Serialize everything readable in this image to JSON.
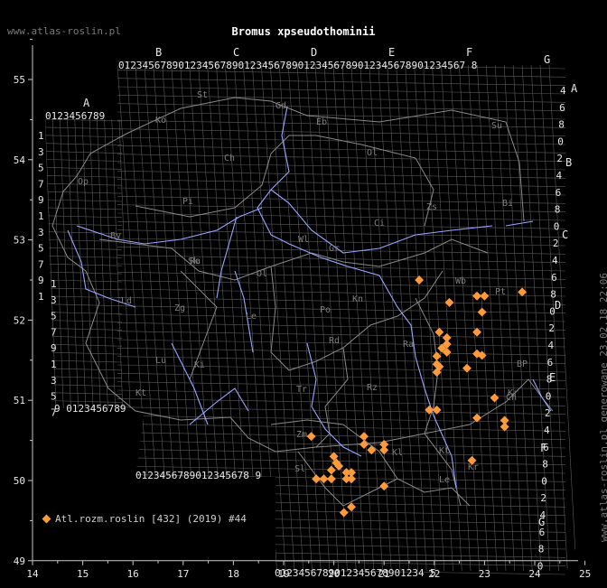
{
  "title": "Bromus xpseudothominii",
  "site": "www.atlas-roslin.pl",
  "side_text": "www.atlas-roslin.pl generowane 23.02.18 22:06",
  "legend": {
    "label": "Atl.rozm.roslin [432] (2019) #44"
  },
  "colors": {
    "background": "#000000",
    "axis": "#c8c8c8",
    "grid": "#5a5a5a",
    "rivers": "#9aa6ff",
    "border": "#8a8a8a",
    "marker": "#ff9a3a",
    "grid_label": "#e8e8e8",
    "region_label": "#7f7f7f",
    "title": "#ffffff"
  },
  "axes": {
    "x_ticks": [
      "14",
      "15",
      "16",
      "17",
      "18",
      "19",
      "20",
      "21",
      "22",
      "23",
      "24",
      "25"
    ],
    "y_ticks": [
      "55",
      "54",
      "53",
      "52",
      "51",
      "50",
      "49"
    ],
    "xlim": [
      14,
      25
    ],
    "ylim": [
      49,
      55.8
    ]
  },
  "grid": {
    "col_letters": [
      "A",
      "B",
      "C",
      "D",
      "E",
      "F",
      "G"
    ],
    "top_digits": "0123456789012345678901234567890123456789012345678901234567 8",
    "digit_rows": {
      "top_main": "0123456789012345678901234567890123456789012345678901234567 8",
      "top_a": "0123456789",
      "bottom_left": "9 0123456789",
      "bottom_b": "0123456789012345678 9",
      "bottom_right": "0123456789012345678901234 5"
    },
    "left_digits": [
      "1",
      "3",
      "5",
      "7",
      "9",
      "1",
      "3",
      "5",
      "7",
      "9",
      "1"
    ],
    "left_digits_2": [
      "1",
      "3",
      "5",
      "7",
      "9",
      "1",
      "3",
      "5",
      "7"
    ],
    "right_letters": [
      "A",
      "B",
      "C",
      "D",
      "E",
      "F",
      "G"
    ],
    "right_digits": [
      "4",
      "6",
      "8",
      "0",
      "2",
      "4",
      "6",
      "8",
      "0",
      "2",
      "4",
      "6",
      "8",
      "0",
      "2",
      "4",
      "6",
      "8",
      "0",
      "2",
      "4",
      "6",
      "8",
      "0",
      "2",
      "4",
      "6",
      "8",
      "0"
    ]
  },
  "region_codes": [
    "St",
    "Gd",
    "Eb",
    "Ko",
    "Ol",
    "Su",
    "Ch",
    "Pi",
    "Bi",
    "Ci",
    "Wl",
    "Gr",
    "By",
    "Ol",
    "Kn",
    "Sk",
    "Po",
    "Ld",
    "Zg",
    "Le",
    "Ra",
    "Pt",
    "Rd",
    "BP",
    "Lu",
    "Ch",
    "Zm",
    "Kl",
    "Kr",
    "Tr",
    "Kt",
    "Op",
    "Wb",
    "Le",
    "Rz",
    "Kt",
    "Sl",
    "Ki",
    "Zs",
    "Kr",
    "Ra"
  ],
  "chart_data": {
    "type": "scatter",
    "xlabel": "",
    "ylabel": "",
    "series": [
      {
        "name": "Atl.rozm.roslin [432] (2019) #44",
        "points": [
          [
            21.7,
            52.5
          ],
          [
            22.3,
            52.22
          ],
          [
            22.85,
            52.3
          ],
          [
            23.0,
            52.3
          ],
          [
            22.95,
            52.1
          ],
          [
            23.75,
            52.35
          ],
          [
            22.1,
            51.85
          ],
          [
            22.25,
            51.78
          ],
          [
            22.25,
            51.7
          ],
          [
            22.85,
            51.85
          ],
          [
            22.15,
            51.65
          ],
          [
            22.25,
            51.6
          ],
          [
            22.05,
            51.55
          ],
          [
            22.85,
            51.58
          ],
          [
            22.95,
            51.56
          ],
          [
            22.05,
            51.45
          ],
          [
            22.1,
            51.42
          ],
          [
            22.05,
            51.35
          ],
          [
            22.65,
            51.4
          ],
          [
            23.2,
            51.03
          ],
          [
            21.9,
            50.88
          ],
          [
            22.05,
            50.88
          ],
          [
            22.85,
            50.78
          ],
          [
            23.4,
            50.75
          ],
          [
            23.4,
            50.67
          ],
          [
            19.55,
            50.55
          ],
          [
            20.6,
            50.55
          ],
          [
            20.6,
            50.45
          ],
          [
            21.0,
            50.45
          ],
          [
            20.75,
            50.38
          ],
          [
            21.0,
            50.38
          ],
          [
            20.0,
            50.3
          ],
          [
            20.05,
            50.22
          ],
          [
            20.1,
            50.18
          ],
          [
            19.95,
            50.13
          ],
          [
            20.25,
            50.1
          ],
          [
            20.35,
            50.1
          ],
          [
            19.65,
            50.02
          ],
          [
            19.8,
            50.02
          ],
          [
            19.95,
            50.02
          ],
          [
            20.25,
            50.02
          ],
          [
            20.35,
            50.02
          ],
          [
            22.75,
            50.25
          ],
          [
            21.0,
            49.93
          ],
          [
            20.35,
            49.67
          ],
          [
            20.2,
            49.6
          ]
        ]
      }
    ]
  }
}
